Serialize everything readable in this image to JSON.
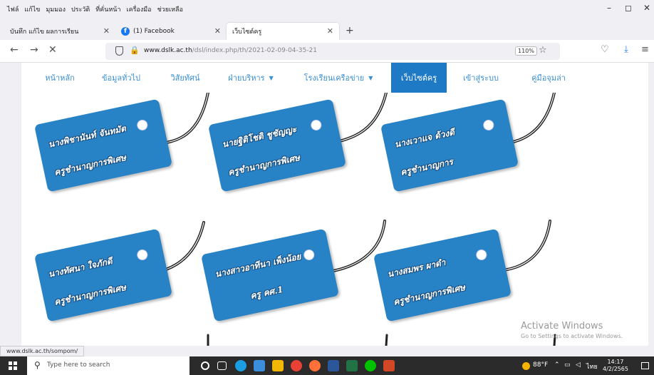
{
  "menubar": {
    "items": [
      "ไฟล์",
      "แก้ไข",
      "มุมมอง",
      "ประวัติ",
      "ที่คั่นหน้า",
      "เครื่องมือ",
      "ช่วยเหลือ"
    ]
  },
  "window_controls": {
    "minimize": "–",
    "maximize": "◻",
    "close": "✕"
  },
  "tabs": [
    {
      "label": "บันทึก แก้ไข ผลการเรียน",
      "close": "✕"
    },
    {
      "label": "(1) Facebook",
      "close": "✕"
    },
    {
      "label": "เว็บไซต์ครู",
      "close": "✕"
    }
  ],
  "newtab_label": "+",
  "navbar": {
    "back": "←",
    "forward": "→",
    "stop": "✕",
    "url_host": "www.dslk.ac.th",
    "url_path": "/dsl/index.php/th/2021-02-09-04-35-21",
    "zoom": "110%",
    "star": "☆",
    "pocket": "♡",
    "download": "⤓",
    "menu": "≡"
  },
  "site_nav": {
    "items": [
      {
        "label": "หน้าหลัก",
        "caret": ""
      },
      {
        "label": "ข้อมูลทั่วไป",
        "caret": ""
      },
      {
        "label": "วิสัยทัศน์",
        "caret": ""
      },
      {
        "label": "ฝ่ายบริหาร",
        "caret": "▼"
      },
      {
        "label": "โรงเรียนเครือข่าย",
        "caret": "▼"
      },
      {
        "label": "เว็บไซต์ครู",
        "caret": ""
      },
      {
        "label": "เข้าสู่ระบบ",
        "caret": ""
      },
      {
        "label": "คู่มือจุมล่า",
        "caret": ""
      }
    ],
    "active_index": 5
  },
  "tags": [
    {
      "name": "นางพิชานันท์ จันทมัต",
      "title": "ครูชำนาญการพิเศษ"
    },
    {
      "name": "นายฐิติโชติ ชูชัญญะ",
      "title": "ครูชำนาญการพิเศษ"
    },
    {
      "name": "นางเวาแจ ด้วงดี",
      "title": "ครูชำนาญการ"
    },
    {
      "name": "นางทัศนา ใจภักดี",
      "title": "ครูชำนาญการพิเศษ"
    },
    {
      "name": "นางสาวอาทีนา เพ็งน้อย",
      "title": "ครู คศ.1"
    },
    {
      "name": "นางสมพร ผาดำ",
      "title": "ครูชำนาญการพิเศษ"
    }
  ],
  "watermark": {
    "line1": "Activate Windows",
    "line2": "Go to Settings to activate Windows."
  },
  "status_url": "www.dslk.ac.th/sompom/",
  "taskbar": {
    "search_placeholder": "Type here to search",
    "weather": "88°F",
    "lang": "ไทย",
    "time": "14:17",
    "date": "4/2/2565"
  },
  "colors": {
    "accent": "#1f7ac6",
    "tag_blue": "#2882c6",
    "nav_text": "#3b8fd1"
  }
}
